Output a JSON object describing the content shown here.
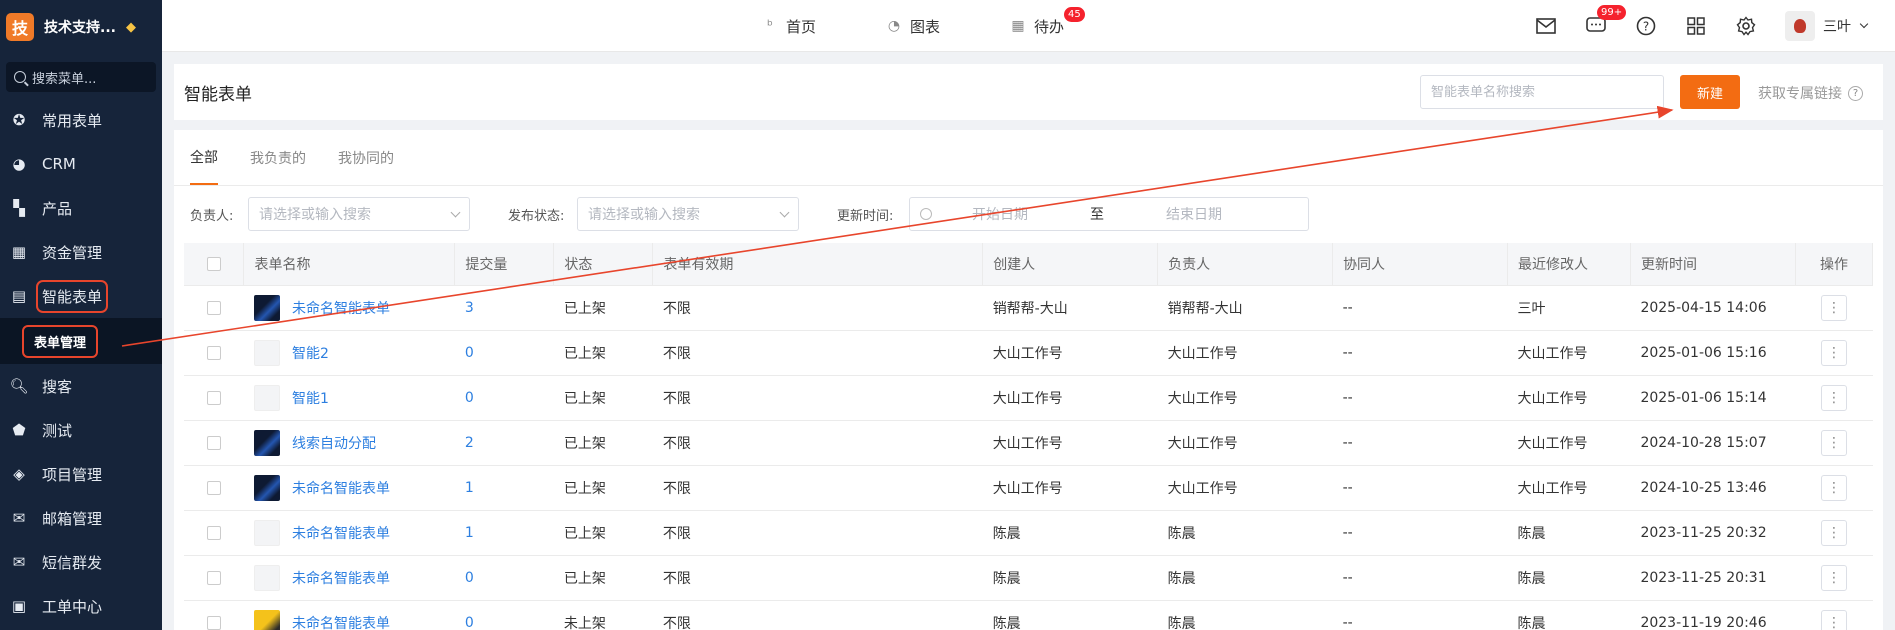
{
  "sidebar": {
    "brand_char": "技",
    "brand_name": "技术支持...",
    "search_label": "搜索菜单...",
    "items": [
      {
        "label": "常用表单",
        "icon": "star-icon"
      },
      {
        "label": "CRM",
        "icon": "pie-chart-icon"
      },
      {
        "label": "产品",
        "icon": "cubes-icon"
      },
      {
        "label": "资金管理",
        "icon": "money-icon"
      },
      {
        "label": "智能表单",
        "icon": "form-icon"
      }
    ],
    "submenu_label": "表单管理",
    "items_after": [
      {
        "label": "搜客",
        "icon": "search-icon"
      },
      {
        "label": "测试",
        "icon": "tag-icon"
      },
      {
        "label": "项目管理",
        "icon": "layers-icon"
      },
      {
        "label": "邮箱管理",
        "icon": "mail-icon"
      },
      {
        "label": "短信群发",
        "icon": "envelope-icon"
      },
      {
        "label": "工单中心",
        "icon": "clipboard-icon"
      }
    ]
  },
  "header": {
    "nav": [
      {
        "label": "首页",
        "icon": "home-icon"
      },
      {
        "label": "图表",
        "icon": "chart-icon"
      },
      {
        "label": "待办",
        "icon": "calendar-icon",
        "badge": "45"
      }
    ],
    "message_badge": "99+",
    "user_name": "三叶"
  },
  "page": {
    "title": "智能表单",
    "search_placeholder": "智能表单名称搜索",
    "new_button": "新建",
    "link_label": "获取专属链接"
  },
  "tabs": [
    "全部",
    "我负责的",
    "我协同的"
  ],
  "filters": {
    "owner_label": "负责人:",
    "owner_placeholder": "请选择或输入搜索",
    "status_label": "发布状态:",
    "status_placeholder": "请选择或输入搜索",
    "time_label": "更新时间:",
    "start_placeholder": "开始日期",
    "range_sep": "至",
    "end_placeholder": "结束日期"
  },
  "table": {
    "columns": [
      "表单名称",
      "提交量",
      "状态",
      "表单有效期",
      "创建人",
      "负责人",
      "协同人",
      "最近修改人",
      "更新时间",
      "操作"
    ],
    "rows": [
      {
        "thumb": "dark",
        "name": "未命名智能表单",
        "count": "3",
        "status": "已上架",
        "valid": "不限",
        "creator": "销帮帮-大山",
        "owner": "销帮帮-大山",
        "collab": "--",
        "modifier": "三叶",
        "time": "2025-04-15 14:06"
      },
      {
        "thumb": "light",
        "name": "智能2",
        "count": "0",
        "status": "已上架",
        "valid": "不限",
        "creator": "大山工作号",
        "owner": "大山工作号",
        "collab": "--",
        "modifier": "大山工作号",
        "time": "2025-01-06 15:16"
      },
      {
        "thumb": "light",
        "name": "智能1",
        "count": "0",
        "status": "已上架",
        "valid": "不限",
        "creator": "大山工作号",
        "owner": "大山工作号",
        "collab": "--",
        "modifier": "大山工作号",
        "time": "2025-01-06 15:14"
      },
      {
        "thumb": "dark",
        "name": "线索自动分配",
        "count": "2",
        "status": "已上架",
        "valid": "不限",
        "creator": "大山工作号",
        "owner": "大山工作号",
        "collab": "--",
        "modifier": "大山工作号",
        "time": "2024-10-28 15:07"
      },
      {
        "thumb": "dark",
        "name": "未命名智能表单",
        "count": "1",
        "status": "已上架",
        "valid": "不限",
        "creator": "大山工作号",
        "owner": "大山工作号",
        "collab": "--",
        "modifier": "大山工作号",
        "time": "2024-10-25 13:46"
      },
      {
        "thumb": "light",
        "name": "未命名智能表单",
        "count": "1",
        "status": "已上架",
        "valid": "不限",
        "creator": "陈晨",
        "owner": "陈晨",
        "collab": "--",
        "modifier": "陈晨",
        "time": "2023-11-25 20:32"
      },
      {
        "thumb": "light",
        "name": "未命名智能表单",
        "count": "0",
        "status": "已上架",
        "valid": "不限",
        "creator": "陈晨",
        "owner": "陈晨",
        "collab": "--",
        "modifier": "陈晨",
        "time": "2023-11-25 20:31"
      },
      {
        "thumb": "yellow",
        "name": "未命名智能表单",
        "count": "0",
        "status": "未上架",
        "valid": "不限",
        "creator": "陈晨",
        "owner": "陈晨",
        "collab": "--",
        "modifier": "陈晨",
        "time": "2023-11-19 20:46"
      }
    ],
    "op_label": "⋮"
  },
  "colors": {
    "accent": "#f36c12",
    "sidebar_bg": "#16243a",
    "link": "#2d7fe0",
    "annotation": "#e8452c"
  }
}
